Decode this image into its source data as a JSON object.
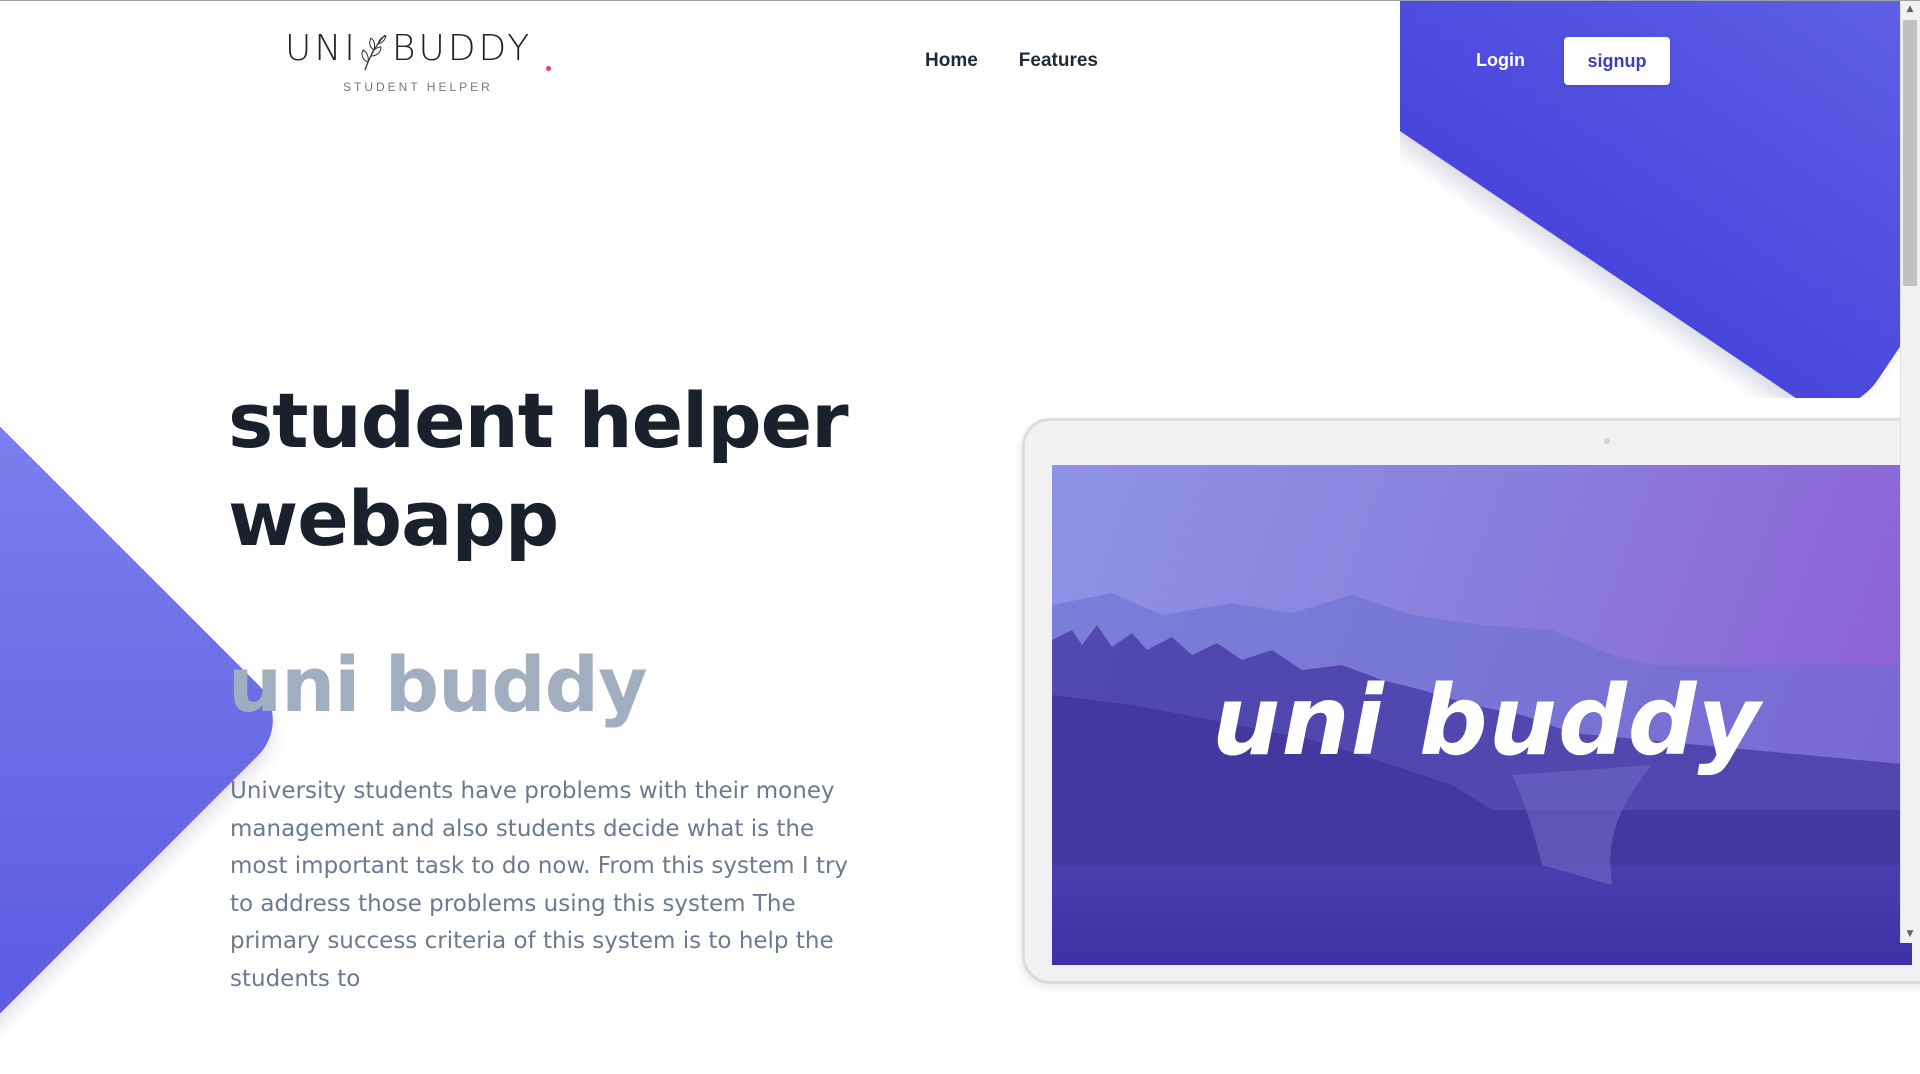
{
  "header": {
    "logo": {
      "left_text": "UNI",
      "right_text": "BUDDY",
      "tagline": "STUDENT HELPER"
    },
    "nav": [
      {
        "label": "Home"
      },
      {
        "label": "Features"
      }
    ],
    "login_label": "Login",
    "signup_label": "signup"
  },
  "hero": {
    "title": "student helper webapp",
    "subtitle": "uni buddy",
    "description": "University students have problems with their money management and also students decide what is the most important task to do now. From this system I try to address those problems using this system The primary success criteria of this system is to help the students to"
  },
  "mockup": {
    "screen_text": "uni buddy"
  },
  "colors": {
    "accent_blue": "#4945dc",
    "accent_pink": "#ee2f80",
    "title": "#1a202c",
    "subtitle": "#a0aec0",
    "body_text": "#6b7a90"
  }
}
